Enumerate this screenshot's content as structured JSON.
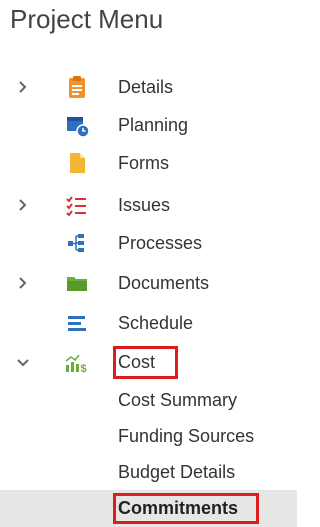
{
  "header": {
    "title": "Project Menu"
  },
  "menu": {
    "items": [
      {
        "label": "Details",
        "icon": "clipboard-icon",
        "chevron": "right"
      },
      {
        "label": "Planning",
        "icon": "calendar-clock-icon",
        "chevron": ""
      },
      {
        "label": "Forms",
        "icon": "document-icon",
        "chevron": ""
      },
      {
        "label": "Issues",
        "icon": "checklist-icon",
        "chevron": "right"
      },
      {
        "label": "Processes",
        "icon": "flow-icon",
        "chevron": ""
      },
      {
        "label": "Documents",
        "icon": "folder-icon",
        "chevron": "right"
      },
      {
        "label": "Schedule",
        "icon": "schedule-lines-icon",
        "chevron": ""
      },
      {
        "label": "Cost",
        "icon": "cost-chart-icon",
        "chevron": "down",
        "expanded": true
      }
    ],
    "cost_children": [
      {
        "label": "Cost Summary"
      },
      {
        "label": "Funding Sources"
      },
      {
        "label": "Budget Details"
      },
      {
        "label": "Commitments",
        "selected": true
      }
    ]
  },
  "colors": {
    "highlight": "#e01b1b",
    "selected_bg": "#e6e6e6",
    "orange": "#f0932b",
    "blue": "#2f6fbf",
    "green": "#6cae3a",
    "red": "#d9303a",
    "yellow": "#f3b635"
  }
}
